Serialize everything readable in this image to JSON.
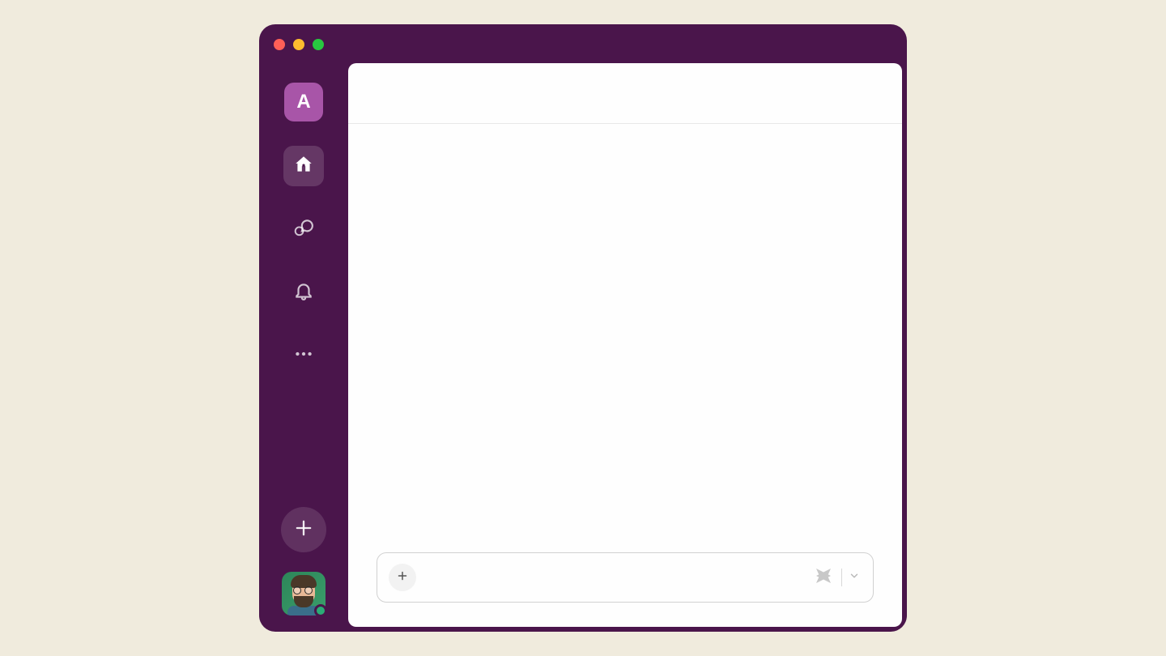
{
  "workspace": {
    "letter": "A"
  },
  "nav": {
    "items": [
      {
        "name": "home",
        "active": true
      },
      {
        "name": "dms",
        "active": false
      },
      {
        "name": "activity",
        "active": false
      },
      {
        "name": "more",
        "active": false
      }
    ]
  },
  "user": {
    "status": "active"
  },
  "composer": {
    "placeholder": ""
  },
  "colors": {
    "sidebar": "#4a154b",
    "accent": "#a855a8",
    "background": "#f0ebdd",
    "status_active": "#2bac76"
  }
}
